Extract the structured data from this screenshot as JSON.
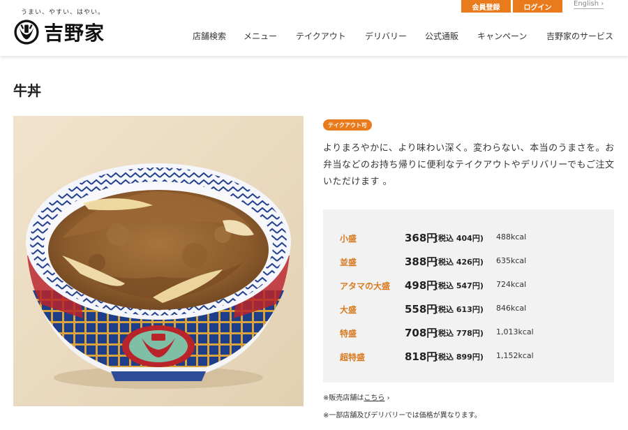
{
  "header": {
    "tagline": "うまい、やすい、はやい。",
    "logo_text": "吉野家",
    "member_button": "会員登録",
    "login_button": "ログイン",
    "english_link": "English",
    "english_chevron": "›",
    "nav": [
      "店舗検索",
      "メニュー",
      "テイクアウト",
      "デリバリー",
      "公式通販",
      "キャンペーン",
      "吉野家のサービス"
    ]
  },
  "page": {
    "title": "牛丼",
    "badge": "テイクアウト可",
    "description": "よりまろやかに、より味わい深く。変わらない、本当のうまさを。お弁当などのお持ち帰りに便利なテイクアウトやデリバリーでもご注文いただけます 。"
  },
  "prices": [
    {
      "size": "小盛",
      "price": "368円",
      "tax": "(税込 404円)",
      "kcal": "488kcal"
    },
    {
      "size": "並盛",
      "price": "388円",
      "tax": "(税込 426円)",
      "kcal": "635kcal"
    },
    {
      "size": "アタマの大盛",
      "price": "498円",
      "tax": "(税込 547円)",
      "kcal": "724kcal"
    },
    {
      "size": "大盛",
      "price": "558円",
      "tax": "(税込 613円)",
      "kcal": "846kcal"
    },
    {
      "size": "特盛",
      "price": "708円",
      "tax": "(税込 778円)",
      "kcal": "1,013kcal"
    },
    {
      "size": "超特盛",
      "price": "818円",
      "tax": "(税込 899円)",
      "kcal": "1,152kcal"
    }
  ],
  "notes": {
    "store_prefix": "※販売店舗は",
    "store_link": "こちら",
    "store_chevron": "›",
    "delivery_note": "※一部店舗及びデリバリーでは価格が異なります。"
  },
  "colors": {
    "accent": "#ea7b1c",
    "size_label": "#d9791f",
    "price_box_bg": "#f2f2f2"
  },
  "icons": {
    "logo": "yoshinoya-logo-icon",
    "chevron": "chevron-right-icon"
  }
}
